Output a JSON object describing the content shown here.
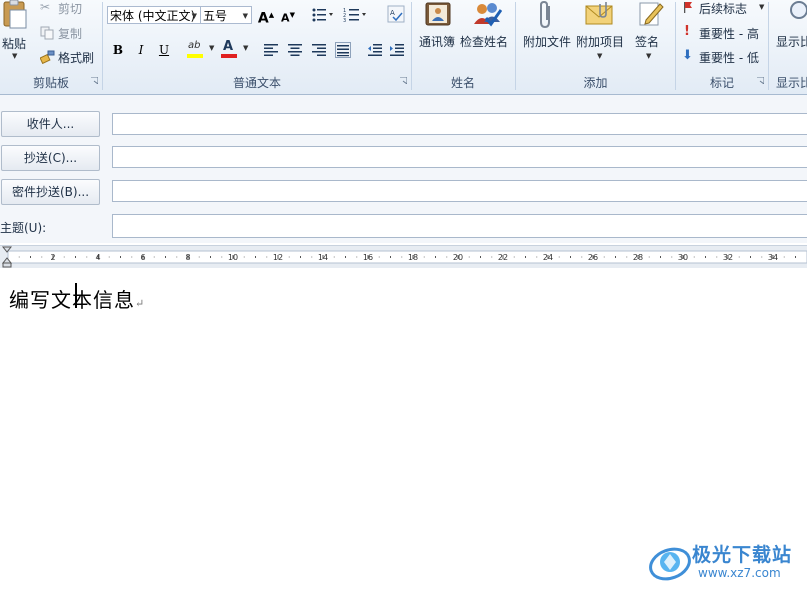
{
  "clipboard": {
    "paste": "粘贴",
    "cut": "剪切",
    "copy": "复制",
    "format_painter": "格式刷",
    "title": "剪贴板"
  },
  "basic_text": {
    "font_name": "宋体 (中文正文)",
    "font_size": "五号",
    "grow_font": "A",
    "shrink_font": "A",
    "bold": "B",
    "italic": "I",
    "underline": "U",
    "font_color": "A",
    "highlight": "ab",
    "title": "普通文本"
  },
  "names": {
    "address_book": "通讯簿",
    "check_names": "检查姓名",
    "title": "姓名"
  },
  "include": {
    "attach_file": "附加文件",
    "attach_item": "附加项目",
    "signature": "签名",
    "title": "添加"
  },
  "tags": {
    "follow_up": "后续标志",
    "high_importance": "重要性 - 高",
    "low_importance": "重要性 - 低",
    "title": "标记"
  },
  "zoom": {
    "show": "显示比",
    "title": "显示比"
  },
  "header": {
    "to_button": "收件人...",
    "cc_button": "抄送(C)...",
    "bcc_button": "密件抄送(B)...",
    "subject_label": "主题(U):",
    "to_value": "",
    "cc_value": "",
    "bcc_value": "",
    "subject_value": ""
  },
  "ruler": {
    "ticks": [
      "2",
      "4",
      "6",
      "8",
      "10",
      "12",
      "14",
      "16",
      "18",
      "20",
      "22",
      "24",
      "26",
      "28",
      "30",
      "32",
      "34"
    ]
  },
  "message": {
    "body": "编写文本信息",
    "paragraph_mark": "↵"
  },
  "watermark": {
    "brand": "极光下载站",
    "url": "www.xz7.com"
  },
  "colors": {
    "highlight": "#ffff00",
    "font_color": "#e02020",
    "ribbon_border": "#a7bad0"
  }
}
